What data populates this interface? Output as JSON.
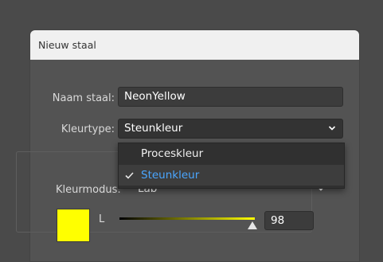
{
  "dialog": {
    "title": "Nieuw staal"
  },
  "name_field": {
    "label": "Naam staal:",
    "value": "NeonYellow"
  },
  "color_type": {
    "label": "Kleurtype:",
    "selected": "Steunkleur",
    "options": [
      "Proceskleur",
      "Steunkleur"
    ],
    "chevron_icon": "chevron-down-icon"
  },
  "color_mode": {
    "label": "Kleurmodus:",
    "value": "Lab"
  },
  "sliders": {
    "l_label": "L",
    "l_value": "98",
    "l_fraction": 0.98
  },
  "colors": {
    "swatch": "#ffff00",
    "accent": "#4aa6ff"
  }
}
